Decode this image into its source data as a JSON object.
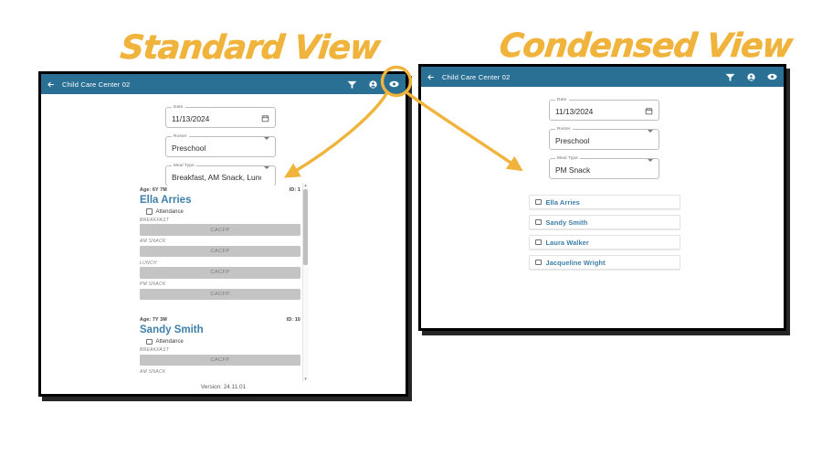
{
  "annotations": {
    "standard_title": "Standard View",
    "condensed_title": "Condensed View",
    "accent_color": "#f0b33c",
    "highlight_target": "visibility-toggle-icon"
  },
  "theme": {
    "appbar_color": "#2a7094",
    "name_color": "#3d7fa8",
    "button_color": "#c4c4c4",
    "frame_color": "#000000"
  },
  "standard_view": {
    "appbar": {
      "back_icon": "arrow-left-icon",
      "title": "Child Care Center 02",
      "icons": [
        {
          "name": "filter-icon",
          "glyph": "filter"
        },
        {
          "name": "account-icon",
          "glyph": "account"
        },
        {
          "name": "visibility-icon",
          "glyph": "eye"
        }
      ]
    },
    "form": {
      "date": {
        "label": "Date",
        "value": "11/13/2024",
        "trailing_icon": "calendar-icon"
      },
      "roster": {
        "label": "Roster",
        "value": "Preschool",
        "trailing_icon": "chevron-down-icon"
      },
      "meal_type": {
        "label": "Meal Type",
        "value": "Breakfast, AM Snack, Lunch, P...",
        "trailing_icon": "chevron-down-icon"
      }
    },
    "students": [
      {
        "age": "Age: 6Y 7M",
        "id": "ID: 1",
        "name": "Ella Arries",
        "attendance_label": "Attendance",
        "attendance_checked": false,
        "meals": [
          {
            "label": "BREAKFAST",
            "button": "CACFP"
          },
          {
            "label": "AM SNACK",
            "button": "CACFP"
          },
          {
            "label": "LUNCH",
            "button": "CACFP"
          },
          {
            "label": "PM SNACK",
            "button": "CACFP"
          }
        ]
      },
      {
        "age": "Age: 7Y 3M",
        "id": "ID: 10",
        "name": "Sandy Smith",
        "attendance_label": "Attendance",
        "attendance_checked": false,
        "meals": [
          {
            "label": "BREAKFAST",
            "button": "CACFP"
          },
          {
            "label": "AM SNACK",
            "button": "CACFP"
          }
        ]
      }
    ],
    "scroll": {
      "up_glyph": "▴",
      "down_glyph": "▾"
    },
    "version": "Version: 24.11.01"
  },
  "condensed_view": {
    "appbar": {
      "back_icon": "arrow-left-icon",
      "title": "Child Care Center 02",
      "icons": [
        {
          "name": "filter-icon",
          "glyph": "filter"
        },
        {
          "name": "account-icon",
          "glyph": "account"
        },
        {
          "name": "visibility-icon",
          "glyph": "eye"
        }
      ]
    },
    "form": {
      "date": {
        "label": "Date",
        "value": "11/13/2024",
        "trailing_icon": "calendar-icon"
      },
      "roster": {
        "label": "Roster",
        "value": "Preschool",
        "trailing_icon": "chevron-down-icon"
      },
      "meal_type": {
        "label": "Meal Type",
        "value": "PM Snack",
        "trailing_icon": "chevron-down-icon"
      }
    },
    "students": [
      {
        "name": "Ella Arries",
        "checked": false
      },
      {
        "name": "Sandy Smith",
        "checked": false
      },
      {
        "name": "Laura Walker",
        "checked": false
      },
      {
        "name": "Jacqueline Wright",
        "checked": false
      }
    ]
  }
}
